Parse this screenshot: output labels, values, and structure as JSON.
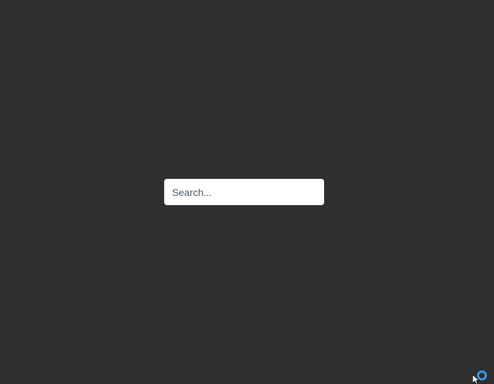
{
  "search": {
    "placeholder": "Search...",
    "value": ""
  },
  "colors": {
    "background": "#2f2f2f",
    "input_background": "#ffffff",
    "placeholder_text": "#4a5666",
    "indicator": "#3b9be8"
  },
  "icons": {
    "cursor": "mouse-pointer-icon",
    "indicator": "loading-ring-icon"
  }
}
